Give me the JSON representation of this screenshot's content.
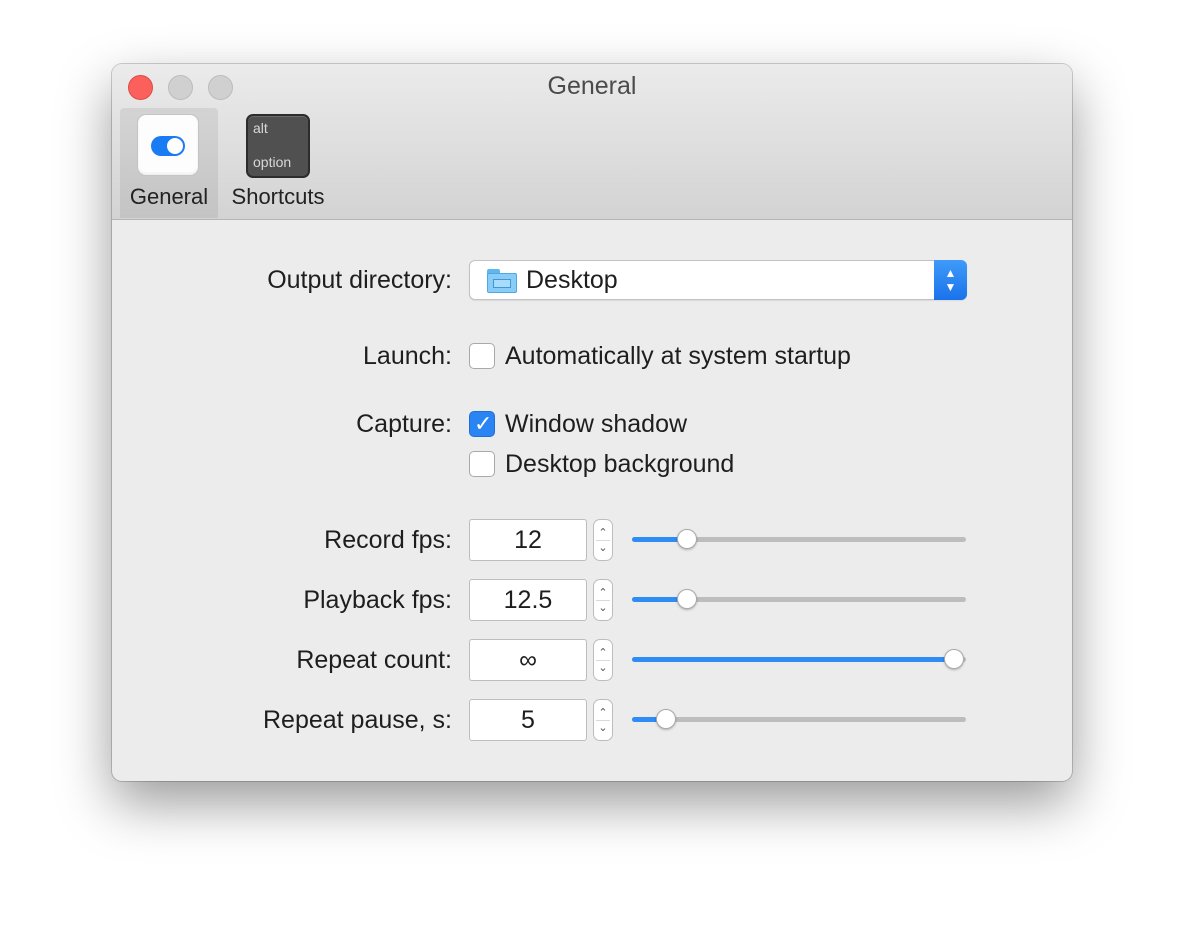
{
  "window": {
    "title": "General"
  },
  "toolbar": {
    "items": [
      {
        "label": "General",
        "icon": "toggle-icon",
        "selected": true
      },
      {
        "label": "Shortcuts",
        "icon": "option-key-icon",
        "key_top": "alt",
        "key_bottom": "option"
      }
    ]
  },
  "output": {
    "label": "Output directory:",
    "value": "Desktop",
    "icon": "folder-icon"
  },
  "launch": {
    "label": "Launch:",
    "option": "Automatically at system startup",
    "checked": false
  },
  "capture": {
    "label": "Capture:",
    "options": [
      {
        "text": "Window shadow",
        "checked": true
      },
      {
        "text": "Desktop background",
        "checked": false
      }
    ]
  },
  "settings": [
    {
      "label": "Record fps:",
      "value": "12",
      "level": 0.14
    },
    {
      "label": "Playback fps:",
      "value": "12.5",
      "level": 0.14
    },
    {
      "label": "Repeat count:",
      "value": "∞",
      "level": 1.0
    },
    {
      "label": "Repeat pause, s:",
      "value": "5",
      "level": 0.07
    }
  ],
  "colors": {
    "accent": "#2f8cf4",
    "close": "#fc605c"
  }
}
